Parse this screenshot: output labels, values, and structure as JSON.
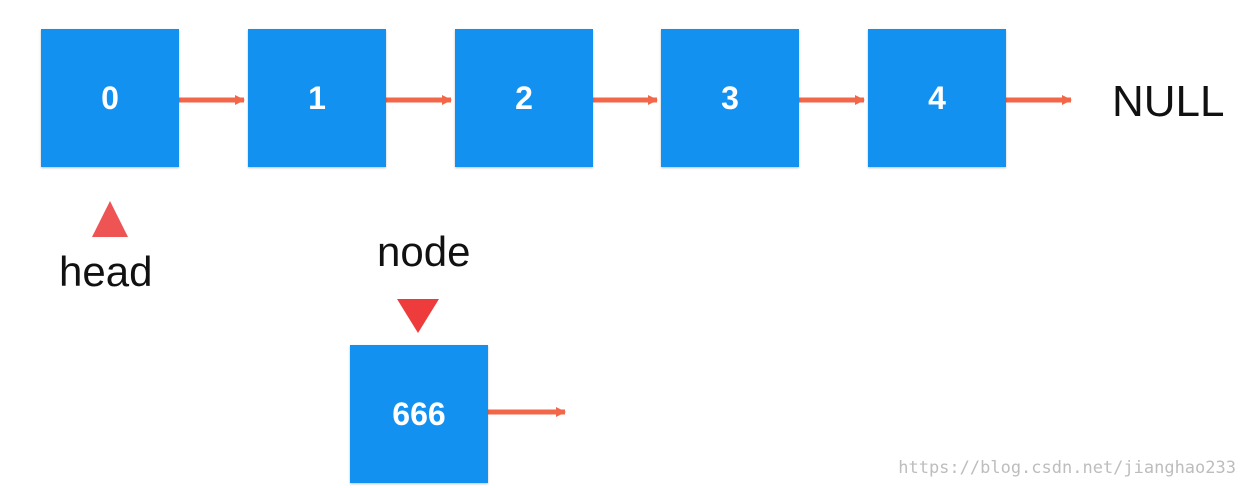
{
  "nodes": [
    {
      "label": "0"
    },
    {
      "label": "1"
    },
    {
      "label": "2"
    },
    {
      "label": "3"
    },
    {
      "label": "4"
    }
  ],
  "new_node": {
    "label": "666"
  },
  "terminal_label": "NULL",
  "head_pointer_label": "head",
  "node_pointer_label": "node",
  "watermark": "https://blog.csdn.net/jianghao233",
  "colors": {
    "node_fill": "#1291f0",
    "node_text": "#ffffff",
    "arrow": "#f26749",
    "head_marker": "#ee5454",
    "node_marker": "#ee3b3b"
  }
}
